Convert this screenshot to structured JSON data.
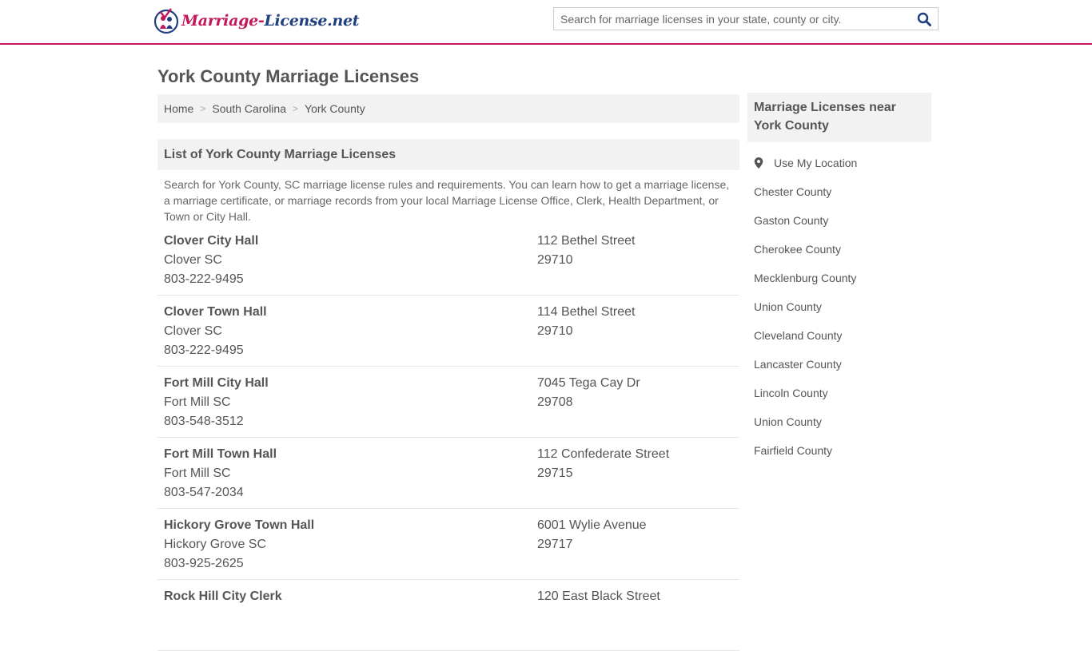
{
  "header": {
    "logo_part1": "Marriage-",
    "logo_part2": "License.net",
    "search_placeholder": "Search for marriage licenses in your state, county or city."
  },
  "page": {
    "title": "York County Marriage Licenses"
  },
  "breadcrumb": [
    "Home",
    "South Carolina",
    "York County"
  ],
  "section": {
    "title": "List of York County Marriage Licenses",
    "intro": "Search for York County, SC marriage license rules and requirements. You can learn how to get a marriage license, a marriage certificate, or marriage records from your local Marriage License Office, Clerk, Health Department, or Town or City Hall."
  },
  "listings": [
    {
      "name": "Clover City Hall",
      "city": "Clover SC",
      "phone": "803-222-9495",
      "street": "112 Bethel Street",
      "zip": "29710"
    },
    {
      "name": "Clover Town Hall",
      "city": "Clover SC",
      "phone": "803-222-9495",
      "street": "114 Bethel Street",
      "zip": "29710"
    },
    {
      "name": "Fort Mill City Hall",
      "city": "Fort Mill SC",
      "phone": "803-548-3512",
      "street": "7045 Tega Cay Dr",
      "zip": "29708"
    },
    {
      "name": "Fort Mill Town Hall",
      "city": "Fort Mill SC",
      "phone": "803-547-2034",
      "street": "112 Confederate Street",
      "zip": "29715"
    },
    {
      "name": "Hickory Grove Town Hall",
      "city": "Hickory Grove SC",
      "phone": "803-925-2625",
      "street": "6001 Wylie Avenue",
      "zip": "29717"
    },
    {
      "name": "Rock Hill City Clerk",
      "city": "",
      "phone": "",
      "street": "120 East Black Street",
      "zip": ""
    }
  ],
  "sidebar": {
    "title": "Marriage Licenses near York County",
    "use_location": "Use My Location",
    "counties": [
      "Chester County",
      "Gaston County",
      "Cherokee County",
      "Mecklenburg County",
      "Union County",
      "Cleveland County",
      "Lancaster County",
      "Lincoln County",
      "Union County",
      "Fairfield County"
    ]
  },
  "colors": {
    "brand_pink": "#c2185b",
    "brand_blue": "#1f3f80",
    "panel_gray": "#f2f2f2"
  },
  "icons": [
    "logo-icon",
    "search-icon",
    "map-pin-icon"
  ]
}
